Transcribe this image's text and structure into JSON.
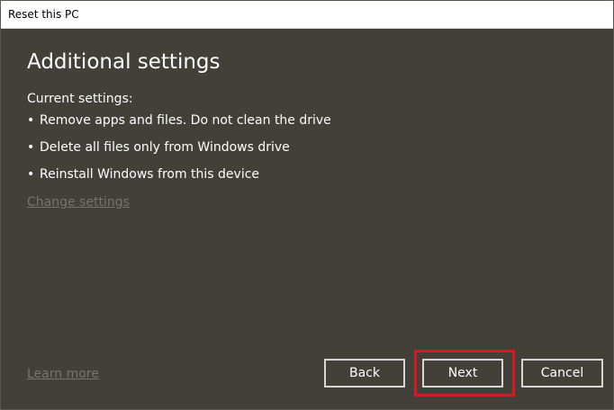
{
  "window": {
    "title": "Reset this PC"
  },
  "main": {
    "heading": "Additional settings",
    "current_settings_label": "Current settings:",
    "bullets": [
      "Remove apps and files. Do not clean the drive",
      "Delete all files only from Windows drive",
      "Reinstall Windows from this device"
    ],
    "bullet_glyph": "•",
    "change_settings_link": "Change settings"
  },
  "footer": {
    "learn_more_link": "Learn more",
    "back_label": "Back",
    "next_label": "Next",
    "cancel_label": "Cancel"
  },
  "colors": {
    "dialog_background": "#434039",
    "text": "#ffffff",
    "disabled_link": "#77746e",
    "button_border": "#d7d6d4",
    "highlight": "#d71921"
  }
}
